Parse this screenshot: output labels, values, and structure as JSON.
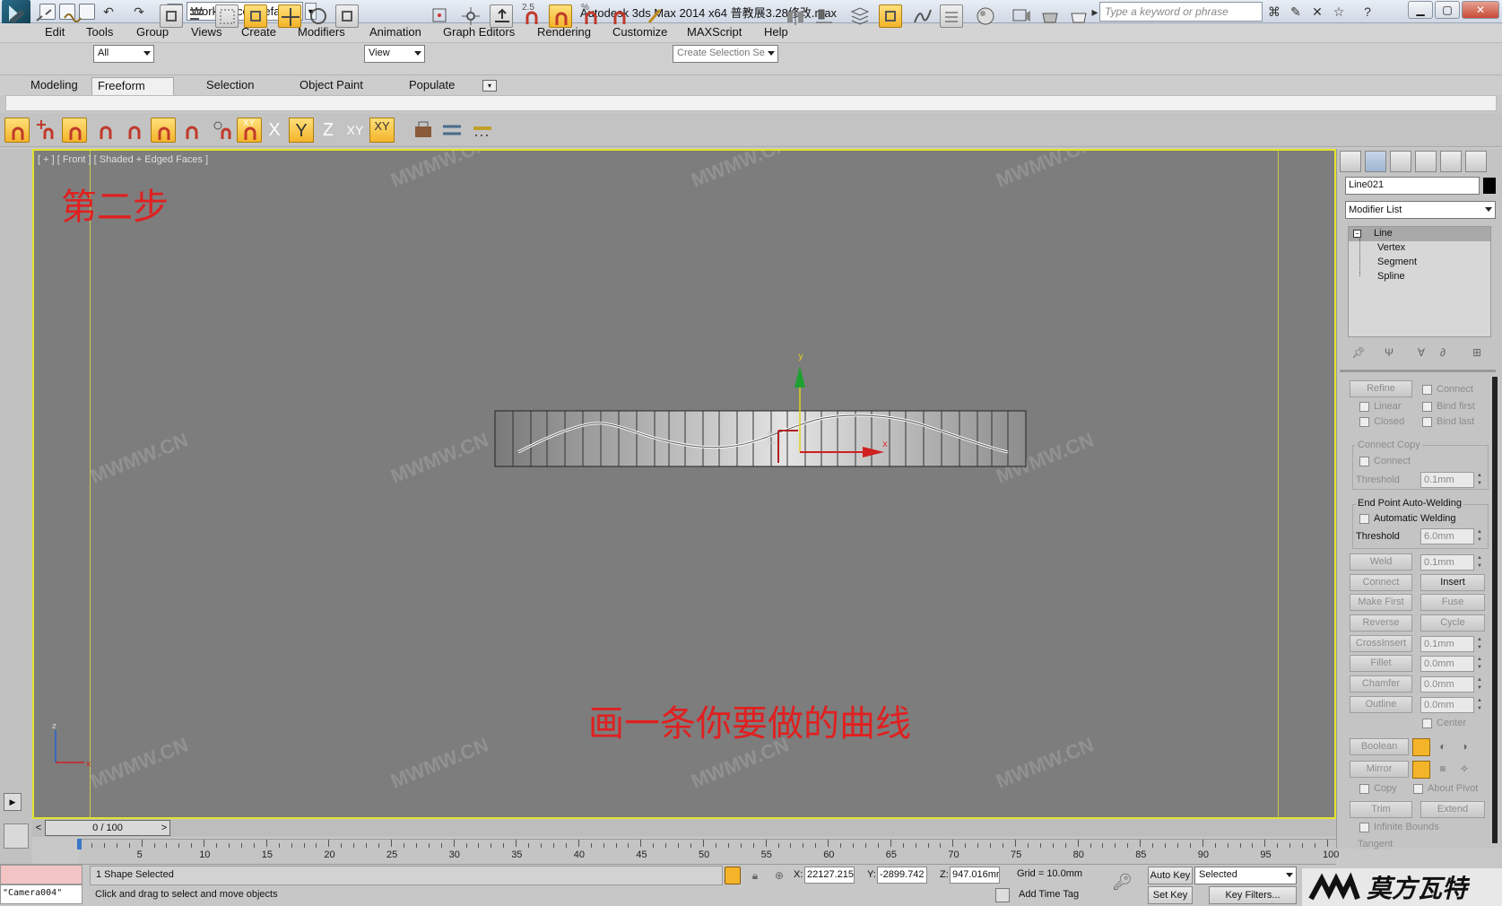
{
  "titlebar": {
    "workspace": "Workspace: Default",
    "title": "Autodesk 3ds Max  2014 x64     普教展3.28修改.max",
    "search_placeholder": "Type a keyword or phrase"
  },
  "menu": [
    "Edit",
    "Tools",
    "Group",
    "Views",
    "Create",
    "Modifiers",
    "Animation",
    "Graph Editors",
    "Rendering",
    "Customize",
    "MAXScript",
    "Help"
  ],
  "toolbar": {
    "selection_filter": "All",
    "ref_coord": "View",
    "snap_angle_label": "2.5",
    "named_selection": "Create Selection Se"
  },
  "ribbon": {
    "tabs": [
      "Modeling",
      "Freeform",
      "Selection",
      "Object Paint",
      "Populate"
    ],
    "active": "Freeform"
  },
  "axis_constraints": [
    "X",
    "Y",
    "Z",
    "XY",
    "XY"
  ],
  "viewport": {
    "label": "[ + ] [ Front ] [ Shaded + Edged Faces ]",
    "step_text": "第二步",
    "instruction_text": "画一条你要做的曲线",
    "watermark": "MWMW.CN",
    "gizmo_x": "x",
    "gizmo_y": "y",
    "axis_tripod_z": "z",
    "axis_tripod_x": "x"
  },
  "timeline": {
    "position": "0 / 100",
    "current_frame": 0,
    "total_frames": 100,
    "ticks": [
      5,
      10,
      15,
      20,
      25,
      30,
      35,
      40,
      45,
      50,
      55,
      60,
      65,
      70,
      75,
      80,
      85,
      90,
      95,
      100
    ]
  },
  "status": {
    "maxscript_output": "\"Camera004\"",
    "selection": "1 Shape Selected",
    "prompt": "Click and drag to select and move objects",
    "x_label": "X:",
    "x": "22127.215",
    "y_label": "Y:",
    "y": "-2899.742",
    "z_label": "Z:",
    "z": "947.016mm",
    "grid": "Grid = 10.0mm",
    "add_time_tag": "Add Time Tag",
    "auto_key": "Auto Key",
    "set_key": "Set Key",
    "key_mode": "Selected",
    "key_filters": "Key Filters..."
  },
  "command_panel": {
    "object_name": "Line021",
    "object_color": "#000000",
    "modifier_list": "Modifier List",
    "stack": {
      "base": "Line",
      "subobjects": [
        "Vertex",
        "Segment",
        "Spline"
      ]
    },
    "refine": {
      "refine_label": "Refine",
      "connect_label": "Connect",
      "linear_label": "Linear",
      "bind_first_label": "Bind first",
      "closed_label": "Closed",
      "bind_last_label": "Bind last"
    },
    "connect_copy": {
      "title": "Connect Copy",
      "connect_label": "Connect",
      "threshold_label": "Threshold",
      "threshold": "0.1mm"
    },
    "auto_weld": {
      "title": "End Point Auto-Welding",
      "auto_weld_label": "Automatic Welding",
      "threshold_label": "Threshold",
      "threshold": "6.0mm"
    },
    "ops": {
      "weld": "Weld",
      "weld_value": "0.1mm",
      "connect": "Connect",
      "insert": "Insert",
      "make_first": "Make First",
      "fuse": "Fuse",
      "reverse": "Reverse",
      "cycle": "Cycle",
      "crossinsert": "CrossInsert",
      "crossinsert_value": "0.1mm",
      "fillet": "Fillet",
      "fillet_value": "0.0mm",
      "chamfer": "Chamfer",
      "chamfer_value": "0.0mm",
      "outline": "Outline",
      "outline_value": "0.0mm",
      "center": "Center",
      "boolean": "Boolean",
      "mirror": "Mirror",
      "copy": "Copy",
      "about_pivot": "About Pivot",
      "trim": "Trim",
      "extend": "Extend",
      "infinite_bounds": "Infinite Bounds",
      "tangent": "Tangent"
    }
  },
  "brand_logo": "MW 莫方瓦特",
  "colors": {
    "viewport_border": "#e3e32c",
    "viewport_bg": "#7d7d7d",
    "annotation": "#e02020",
    "active_button": "#f3b42a"
  }
}
